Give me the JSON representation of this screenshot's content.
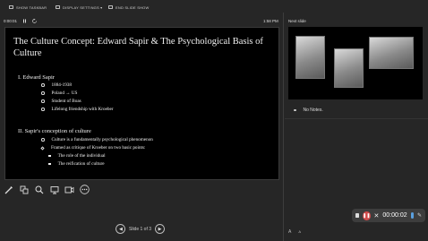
{
  "topbar": {
    "show_taskbar": "SHOW TASKBAR",
    "display_settings": "DISPLAY SETTINGS ▾",
    "end_slide_show": "END SLIDE SHOW"
  },
  "timer": {
    "elapsed": "0:00:01",
    "clock": "1:58 PM"
  },
  "slide": {
    "title": "The Culture Concept: Edward Sapir & The Psychological Basis of Culture",
    "section1": {
      "heading": "I.   Edward Sapir",
      "items": [
        "1884-1938",
        "Poland → US",
        "Student of Boas",
        "Lifelong friendship with Kroeber"
      ]
    },
    "section2": {
      "heading": "II.  Sapir's conception of culture",
      "items": [
        "Culture is a fundamentally psychological phenomenon",
        "Framed as critique of Kroeber on two basic points:"
      ],
      "subitems": [
        "The role of the individual",
        "The reification of culture"
      ]
    }
  },
  "next_slide": {
    "label": "Next slide"
  },
  "notes": {
    "text": "No Notes."
  },
  "navigation": {
    "slide_counter": "Slide 1 of 3"
  },
  "recording": {
    "time": "00:00:02"
  },
  "icons": [
    "pen-icon",
    "slides-grid-icon",
    "zoom-icon",
    "screen-icon",
    "camera-icon",
    "more-icon",
    "play-icon",
    "pause-icon"
  ]
}
